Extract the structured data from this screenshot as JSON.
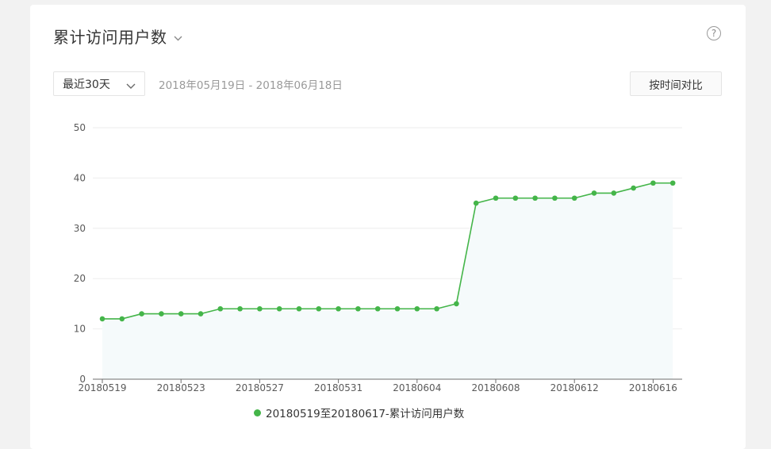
{
  "header": {
    "title": "累计访问用户数",
    "help_symbol": "?"
  },
  "filters": {
    "range_label": "最近30天",
    "date_range": "2018年05月19日 - 2018年06月18日",
    "compare_label": "按时间对比"
  },
  "colors": {
    "accent": "#44b549",
    "area": "#f5fafb"
  },
  "icons": {
    "title_dropdown": "chevron-down-icon",
    "range_dropdown": "chevron-down-icon",
    "help": "question-circle-icon"
  },
  "chart_data": {
    "type": "line",
    "title": "",
    "xlabel": "",
    "ylabel": "",
    "ylim": [
      0,
      50
    ],
    "y_ticks": [
      "0",
      "10",
      "20",
      "30",
      "40",
      "50"
    ],
    "x_tick_labels": [
      "20180519",
      "20180523",
      "20180527",
      "20180531",
      "20180604",
      "20180608",
      "20180612",
      "20180616"
    ],
    "x": [
      "20180519",
      "20180520",
      "20180521",
      "20180522",
      "20180523",
      "20180524",
      "20180525",
      "20180526",
      "20180527",
      "20180528",
      "20180529",
      "20180530",
      "20180531",
      "20180601",
      "20180602",
      "20180603",
      "20180604",
      "20180605",
      "20180606",
      "20180607",
      "20180608",
      "20180609",
      "20180610",
      "20180611",
      "20180612",
      "20180613",
      "20180614",
      "20180615",
      "20180616",
      "20180617"
    ],
    "series": [
      {
        "name": "20180519至20180617-累计访问用户数",
        "values": [
          12,
          12,
          13,
          13,
          13,
          13,
          14,
          14,
          14,
          14,
          14,
          14,
          14,
          14,
          14,
          14,
          14,
          14,
          15,
          35,
          36,
          36,
          36,
          36,
          36,
          37,
          37,
          38,
          39,
          39
        ]
      }
    ],
    "grid": true,
    "legend_position": "bottom"
  }
}
